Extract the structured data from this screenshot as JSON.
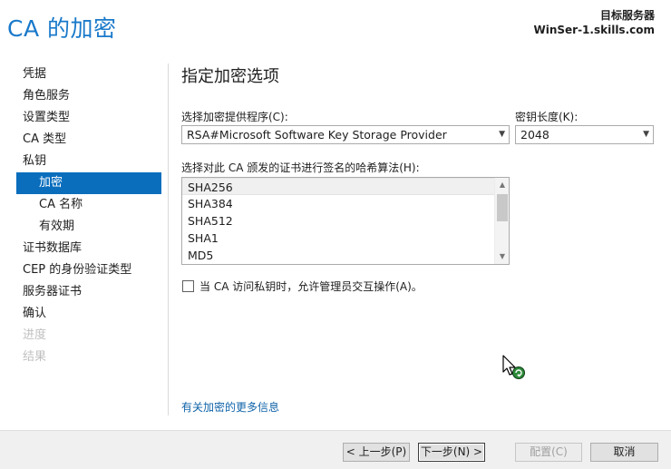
{
  "window": {
    "title": "CA 的加密",
    "server_label": "目标服务器",
    "server_name": "WinSer-1.skills.com"
  },
  "sidebar": {
    "items": [
      {
        "label": "凭据",
        "state": "normal"
      },
      {
        "label": "角色服务",
        "state": "normal"
      },
      {
        "label": "设置类型",
        "state": "normal"
      },
      {
        "label": "CA 类型",
        "state": "normal"
      },
      {
        "label": "私钥",
        "state": "normal"
      },
      {
        "label": "加密",
        "state": "active"
      },
      {
        "label": "CA 名称",
        "state": "normal"
      },
      {
        "label": "有效期",
        "state": "normal"
      },
      {
        "label": "证书数据库",
        "state": "normal"
      },
      {
        "label": "CEP 的身份验证类型",
        "state": "normal"
      },
      {
        "label": "服务器证书",
        "state": "normal"
      },
      {
        "label": "确认",
        "state": "normal"
      },
      {
        "label": "进度",
        "state": "disabled"
      },
      {
        "label": "结果",
        "state": "disabled"
      }
    ]
  },
  "main": {
    "heading": "指定加密选项",
    "provider_label": "选择加密提供程序(C):",
    "provider_value": "RSA#Microsoft Software Key Storage Provider",
    "key_length_label": "密钥长度(K):",
    "key_length_value": "2048",
    "hash_label": "选择对此 CA 颁发的证书进行签名的哈希算法(H):",
    "hash_options": [
      "SHA256",
      "SHA384",
      "SHA512",
      "SHA1",
      "MD5"
    ],
    "hash_selected": "SHA256",
    "interact_checkbox_label": "当 CA 访问私钥时，允许管理员交互操作(A)。",
    "interact_checked": false,
    "more_info_link": "有关加密的更多信息"
  },
  "footer": {
    "back_label": "< 上一步(P)",
    "next_label": "下一步(N) >",
    "configure_label": "配置(C)",
    "cancel_label": "取消"
  },
  "colors": {
    "title": "#1979ca",
    "active_nav": "#0a6ebd",
    "link": "#1164a9"
  }
}
